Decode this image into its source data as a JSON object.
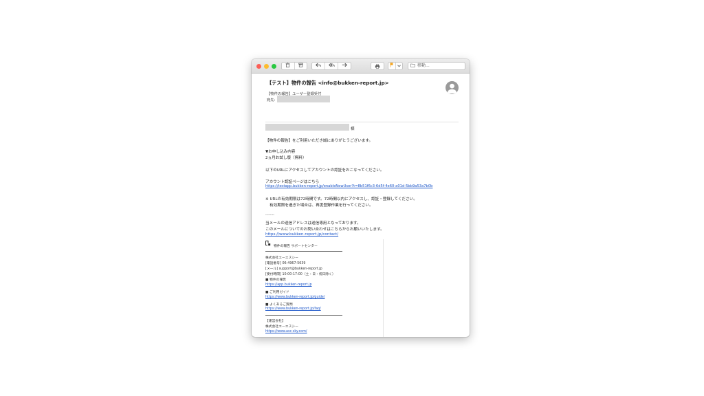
{
  "toolbar": {
    "move_label": "移動..."
  },
  "email": {
    "subject": "【テスト】物件の報告 <info@bukken-report.jp>",
    "to_line": "【物件の報告】ユーザー登録受付",
    "from_label": "宛先:",
    "salutation_suffix": "様",
    "body": {
      "thanks": "【物件の報告】をご利用いただき誠にありがとうございます。",
      "section_head": "▼お申し込み内容",
      "plan": "2ヵ月お試し版（無料）",
      "instruction": "以下のURLにアクセスしてアカウントの認証をおこなってください。",
      "auth_label": "アカウント認証ページはこちら",
      "auth_url": "https://testapp.bukken-report.jp/enableNewUser?t=8b51f6c3-6d5f-4e60-a01d-5bb9a53a7b0b",
      "note1": "※ URLの有効期限は72時間です。72時間以内にアクセスし、認証・登録してください。",
      "note2": "有効期限を過ぎた場合は、再度登録作業を行ってください。",
      "separator": "--------",
      "reply_note1": "当メールの送信アドレスは送信専用となっております。",
      "reply_note2": "このメールについてのお問い合わせはこちらからお願いいたします。",
      "contact_url": "https://www.bukken-report.jp/contact/"
    },
    "signature": {
      "title": "物件の報告 サポートセンター",
      "company": "株式会社エーエスシー",
      "phone": "[電話番号] 06-4967-5639",
      "mail": "[メール] support@bukken-report.jp",
      "hours": "[受付時間] 10:00-17:00（土・日・祝日除く）",
      "app_head": "■ 物件の報告",
      "app_url": "https://app.bukken-report.jp",
      "guide_head": "■ ご利用ガイド",
      "guide_url": "https://www.bukken-report.jp/guide/",
      "faq_head": "■ よくあるご質問",
      "faq_url": "https://www.bukken-report.jp/faq/",
      "operator_head": "【運営会社】",
      "operator": "株式会社エーエスシー",
      "operator_url": "https://www.asc-sky.com/"
    }
  },
  "colors": {
    "close": "#fc5f57",
    "minimize": "#fdbc2e",
    "zoom": "#28c840",
    "flag": "#f5a623",
    "link": "#1a55c9"
  },
  "icons": [
    "trash-icon",
    "archive-icon",
    "reply-icon",
    "reply-all-icon",
    "forward-icon",
    "print-icon",
    "flag-icon",
    "chevron-down-icon",
    "folder-icon",
    "person-icon",
    "logo-icon"
  ]
}
